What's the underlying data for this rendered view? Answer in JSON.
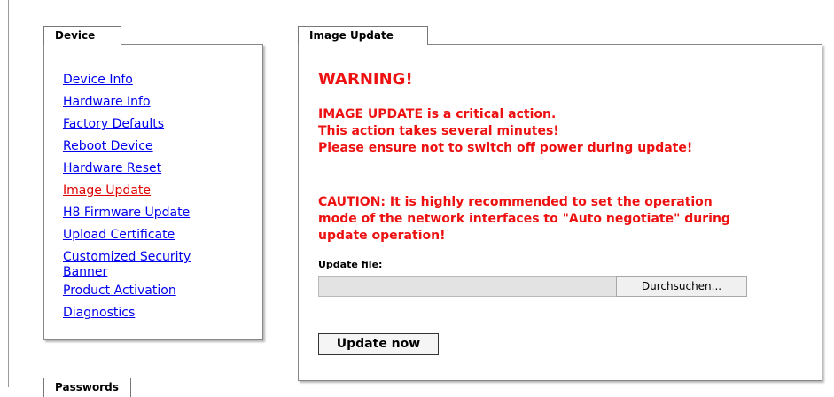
{
  "device_panel": {
    "tab_label": "Device",
    "links": [
      {
        "label": "Device Info"
      },
      {
        "label": "Hardware Info"
      },
      {
        "label": "Factory Defaults"
      },
      {
        "label": "Reboot Device"
      },
      {
        "label": "Hardware Reset"
      },
      {
        "label": "Image Update",
        "active": true
      },
      {
        "label": "H8 Firmware Update"
      },
      {
        "label": "Upload Certificate"
      },
      {
        "label": "Customized Security Banner"
      },
      {
        "label": "Product Activation"
      },
      {
        "label": "Diagnostics"
      }
    ]
  },
  "passwords_panel": {
    "tab_label": "Passwords"
  },
  "image_update_panel": {
    "tab_label": "Image Update",
    "warning_title": "WARNING!",
    "warning_lines": [
      "IMAGE UPDATE is a critical action.",
      "This action takes several minutes!",
      "Please ensure not to switch off power during update!"
    ],
    "caution_text": "CAUTION: It is highly recommended to set the operation mode of the network interfaces to \"Auto negotiate\" during update operation!",
    "update_file_label": "Update file:",
    "browse_label": "Durchsuchen...",
    "update_button_label": "Update now"
  },
  "colors": {
    "link": "#0000ee",
    "active_link": "#e00000",
    "warning": "#ee1111"
  }
}
